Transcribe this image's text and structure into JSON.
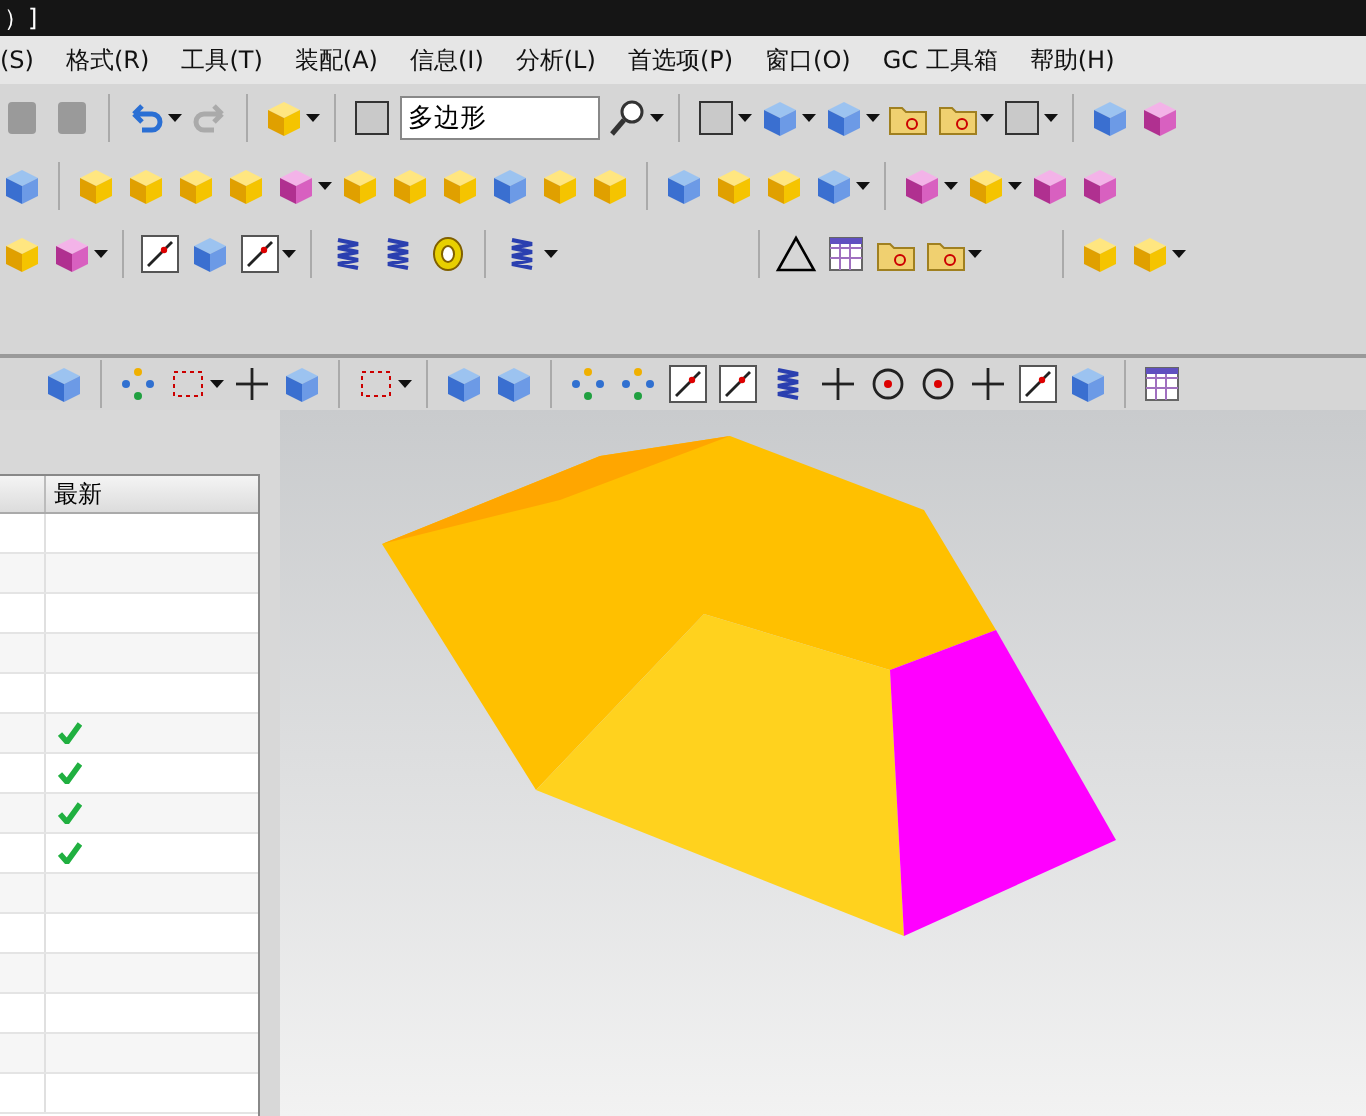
{
  "window": {
    "title": "）]"
  },
  "menu": [
    "(S)",
    "格式(R)",
    "工具(T)",
    "装配(A)",
    "信息(I)",
    "分析(L)",
    "首选项(P)",
    "窗口(O)",
    "GC 工具箱",
    "帮助(H)"
  ],
  "find_field": {
    "value": "多边形"
  },
  "part_navigator": {
    "columns": [
      "最新"
    ],
    "rows": [
      {
        "checked": false
      },
      {
        "checked": false
      },
      {
        "checked": false
      },
      {
        "checked": false
      },
      {
        "checked": false
      },
      {
        "checked": true
      },
      {
        "checked": true
      },
      {
        "checked": true
      },
      {
        "checked": true
      },
      {
        "checked": false
      },
      {
        "checked": false
      },
      {
        "checked": false
      },
      {
        "checked": false
      },
      {
        "checked": false
      },
      {
        "checked": false
      }
    ]
  }
}
